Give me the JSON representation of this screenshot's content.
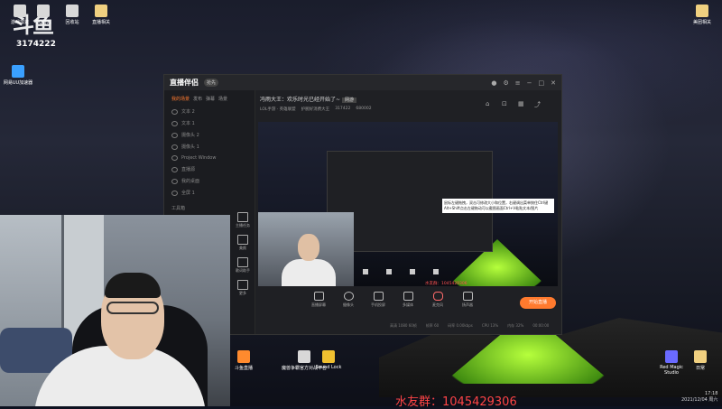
{
  "overlay": {
    "logo": "斗鱼",
    "room_number": "3174222"
  },
  "desktop_icons": {
    "top_left": [
      {
        "label": "游戏加速"
      },
      {
        "label": "QQ游戏"
      },
      {
        "label": "回收站"
      },
      {
        "label": "直播相关"
      }
    ],
    "left": [
      {
        "label": "网易UU加速器"
      }
    ],
    "top_right": [
      {
        "label": "美团相关"
      }
    ],
    "bottom": [
      {
        "label": "斗鱼直播"
      },
      {
        "label": "魔兽争霸官方对战平台"
      },
      {
        "label": "Sound Lock"
      }
    ],
    "bottom_right": [
      {
        "label": "Red Magic Studio"
      },
      {
        "label": "日常"
      }
    ]
  },
  "app": {
    "name": "直播伴侣",
    "badge": "抢先",
    "side_tabs": [
      "我的场景",
      "发布",
      "弹幕",
      "场景"
    ],
    "scene_items": [
      "文本 2",
      "文本 1",
      "摄像头 2",
      "摄像头 1",
      "Project Window",
      "直播源",
      "我的桌面",
      "全屏 1"
    ],
    "tools_label": "工具箱",
    "tools": [
      "主播任务",
      "美颜",
      "歌词助手",
      "更多"
    ],
    "room_title": "冯雨大王：欢乐时光已经开始了~",
    "room_tag": "网游",
    "room_sub": [
      "LOL手游 · 英雄联盟",
      "护腕好消费大王",
      "317422",
      "680002"
    ],
    "preview_tip": "鼠标左键拖拽，双击可修改大小和位置，右键调出菜单按住Ctrl键Alt+Shift点击左键拖动可以截图画面Ctrl+V粘贴文本/图片",
    "preview_room": "水友群：1045429306",
    "bottom_tools": [
      "直播屏幕",
      "摄像头",
      "手机投屏",
      "多媒体",
      "麦克风",
      "扬声器"
    ],
    "live_button": "开始直播",
    "status": [
      "高清 1080 60帧",
      "帧率 60",
      "码率 0.00kbps",
      "CPU 13%",
      "内存 32%",
      "00:00:00"
    ]
  },
  "fans_group": "水友群：1045429306",
  "clock": {
    "time": "17:18",
    "date": "2021/12/04 周六"
  }
}
